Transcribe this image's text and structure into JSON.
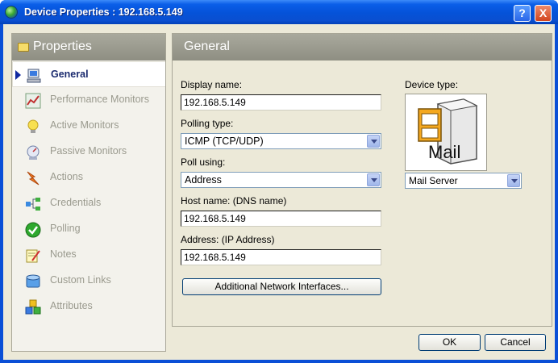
{
  "window": {
    "title": "Device Properties : 192.168.5.149",
    "help_label": "?",
    "close_label": "X"
  },
  "sidebar": {
    "title": "Properties",
    "items": [
      {
        "label": "General",
        "icon": "computer-icon",
        "active": true
      },
      {
        "label": "Performance Monitors",
        "icon": "chart-icon",
        "active": false
      },
      {
        "label": "Active Monitors",
        "icon": "lightbulb-icon",
        "active": false
      },
      {
        "label": "Passive Monitors",
        "icon": "monitor-gauge-icon",
        "active": false
      },
      {
        "label": "Actions",
        "icon": "lightning-icon",
        "active": false
      },
      {
        "label": "Credentials",
        "icon": "network-tree-icon",
        "active": false
      },
      {
        "label": "Polling",
        "icon": "checkmark-icon",
        "active": false
      },
      {
        "label": "Notes",
        "icon": "notepad-icon",
        "active": false
      },
      {
        "label": "Custom Links",
        "icon": "database-icon",
        "active": false
      },
      {
        "label": "Attributes",
        "icon": "blocks-icon",
        "active": false
      }
    ]
  },
  "general": {
    "title": "General",
    "display_name_label": "Display name:",
    "display_name_value": "192.168.5.149",
    "polling_type_label": "Polling type:",
    "polling_type_value": "ICMP (TCP/UDP)",
    "poll_using_label": "Poll using:",
    "poll_using_value": "Address",
    "host_name_label": "Host name: (DNS name)",
    "host_name_value": "192.168.5.149",
    "address_label": "Address: (IP Address)",
    "address_value": "192.168.5.149",
    "additional_interfaces_label": "Additional Network Interfaces...",
    "device_type_label": "Device type:",
    "device_image_text": "Mail",
    "device_type_value": "Mail Server"
  },
  "footer": {
    "ok_label": "OK",
    "cancel_label": "Cancel"
  },
  "colors": {
    "titlebar": "#0552d8",
    "panel_header": "#9c9c90",
    "client_bg": "#ece9d8",
    "active_text": "#1a2a6e"
  }
}
